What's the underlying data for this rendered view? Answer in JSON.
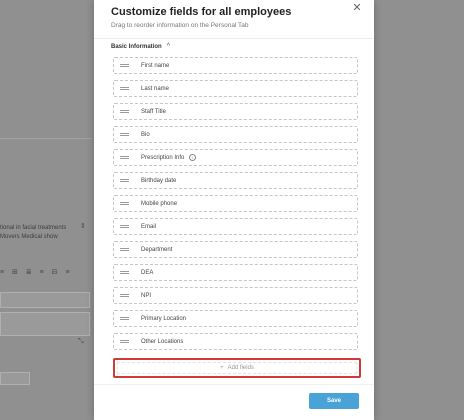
{
  "modal": {
    "title": "Customize fields for all employees",
    "subtitle": "Drag to reorder information on the Personal Tab",
    "close_icon": "close-icon",
    "section_label": "Basic Information",
    "fields": [
      {
        "label": "First name",
        "has_info": false
      },
      {
        "label": "Last name",
        "has_info": false
      },
      {
        "label": "Staff Title",
        "has_info": false
      },
      {
        "label": "Bio",
        "has_info": false
      },
      {
        "label": "Prescription Info",
        "has_info": true
      },
      {
        "label": "Birthday date",
        "has_info": false
      },
      {
        "label": "Mobile phone",
        "has_info": false
      },
      {
        "label": "Email",
        "has_info": false
      },
      {
        "label": "Department",
        "has_info": false
      },
      {
        "label": "DEA",
        "has_info": false
      },
      {
        "label": "NPI",
        "has_info": false
      },
      {
        "label": "Primary Location",
        "has_info": false
      },
      {
        "label": "Other Locations",
        "has_info": false
      }
    ],
    "add_fields_label": "Add fields",
    "save_label": "Save"
  },
  "background": {
    "text_line_1": "tional in facial treatments",
    "text_line_2": "Movers Medical show"
  },
  "colors": {
    "accent": "#4aa3d6",
    "highlight": "#d23a3a"
  }
}
